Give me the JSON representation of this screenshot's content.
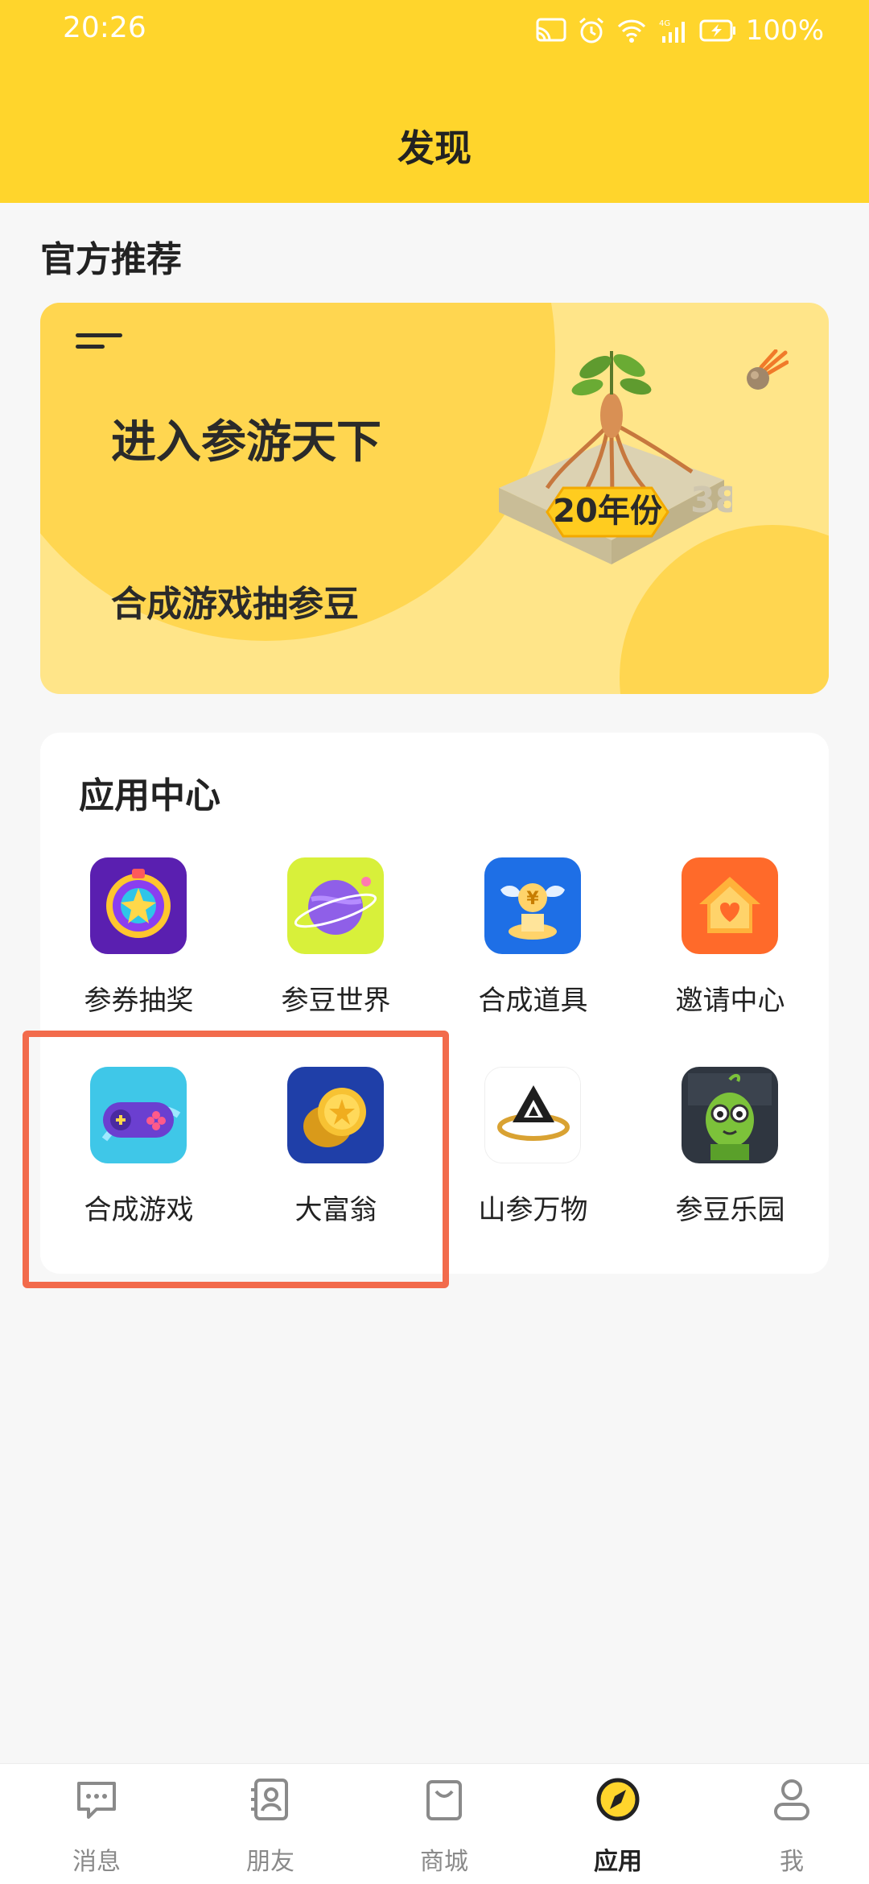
{
  "status_bar": {
    "time": "20:26",
    "battery": "100%",
    "network": "4G"
  },
  "header": {
    "title": "发现"
  },
  "recommend": {
    "title": "官方推荐",
    "banner": {
      "main_text": "进入参游天下",
      "sub_text": "合成游戏抽参豆",
      "badge": "20年份",
      "tag": "38"
    }
  },
  "app_center": {
    "title": "应用中心",
    "apps": [
      {
        "label": "参券抽奖",
        "icon": "lottery-wheel-icon"
      },
      {
        "label": "参豆世界",
        "icon": "planet-icon"
      },
      {
        "label": "合成道具",
        "icon": "winged-coin-icon"
      },
      {
        "label": "邀请中心",
        "icon": "invite-house-icon"
      },
      {
        "label": "合成游戏",
        "icon": "gamepad-icon"
      },
      {
        "label": "大富翁",
        "icon": "gold-coins-icon"
      },
      {
        "label": "山参万物",
        "icon": "mountain-logo-icon"
      },
      {
        "label": "参豆乐园",
        "icon": "bean-character-icon"
      }
    ]
  },
  "colors": {
    "header": "#ffd52c",
    "banner": "#ffe589",
    "highlight": "#f26b4c",
    "active_tab": "#222222"
  },
  "tabbar": {
    "tabs": [
      {
        "label": "消息",
        "icon": "message-icon",
        "active": false
      },
      {
        "label": "朋友",
        "icon": "contacts-icon",
        "active": false
      },
      {
        "label": "商城",
        "icon": "shopping-bag-icon",
        "active": false
      },
      {
        "label": "应用",
        "icon": "compass-icon",
        "active": true
      },
      {
        "label": "我",
        "icon": "person-icon",
        "active": false
      }
    ]
  }
}
